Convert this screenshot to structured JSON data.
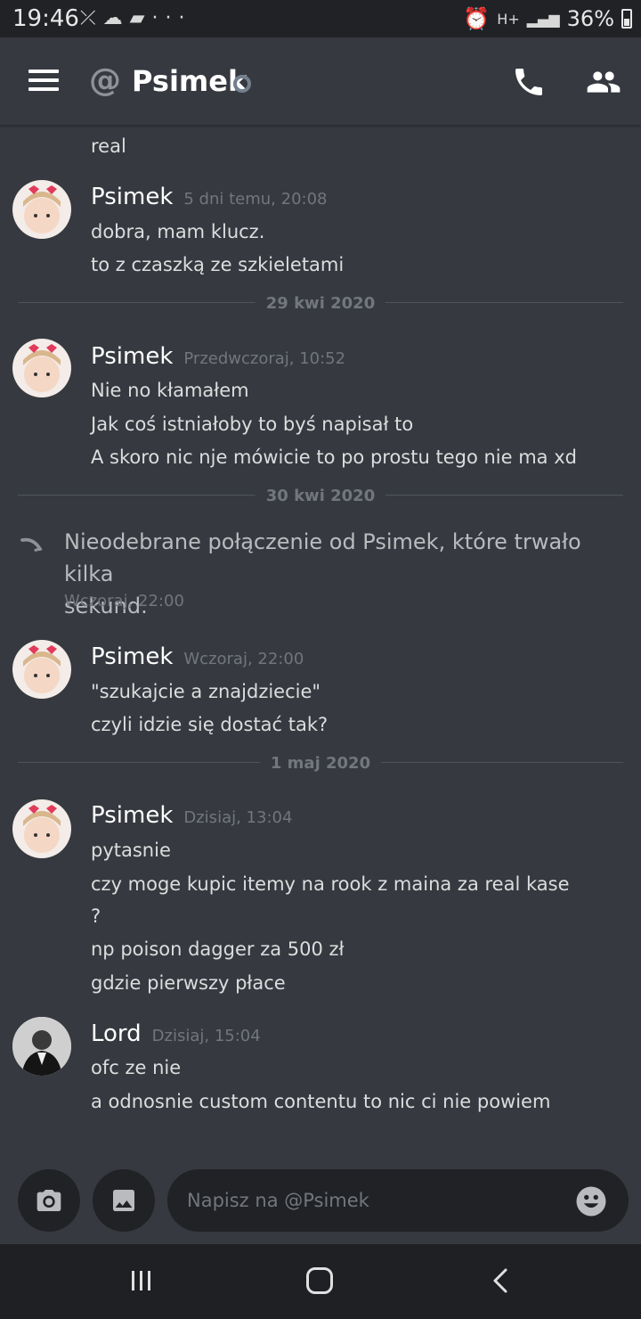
{
  "status_bar": {
    "time": "19:46",
    "notif_icons": [
      "missed-call-icon",
      "weather-icon",
      "message-icon",
      "more-icon"
    ],
    "right_icons": [
      "alarm-icon",
      "network-hplus-icon",
      "signal-icon"
    ],
    "network_label": "H+",
    "battery": "36%"
  },
  "header": {
    "at_symbol": "@",
    "title": "Psimek",
    "status": "offline",
    "icons": [
      "menu-icon",
      "call-icon",
      "friends-icon"
    ]
  },
  "messages": {
    "m0": {
      "line1": "real"
    },
    "m1": {
      "author": "Psimek",
      "timestamp": "5 dni temu, 20:08",
      "line1": "dobra, mam klucz.",
      "line2": "to z czaszką ze szkieletami"
    },
    "d1": "29 kwi 2020",
    "m2": {
      "author": "Psimek",
      "timestamp": "Przedwczoraj, 10:52",
      "line1": "Nie no kłamałem",
      "line2": "Jak coś istniałoby to byś napisał to",
      "line3": "A skoro nic nje mówicie to po prostu tego nie ma xd"
    },
    "d2": "30 kwi 2020",
    "sys": {
      "line1": "Nieodebrane połączenie od Psimek, które trwało kilka",
      "line2": "sekund.",
      "timestamp": "Wczoraj, 22:00"
    },
    "m3": {
      "author": "Psimek",
      "timestamp": "Wczoraj, 22:00",
      "line1": "\"szukajcie a znajdziecie\"",
      "line2": "czyli idzie się dostać tak?"
    },
    "d3": "1 maj 2020",
    "m4": {
      "author": "Psimek",
      "timestamp": "Dzisiaj, 13:04",
      "line1": "pytasnie",
      "line2": "czy moge kupic itemy na rook z maina za real kase",
      "line3": "?",
      "line4": "np poison dagger za 500 zł",
      "line5": "gdzie pierwszy płace"
    },
    "m5": {
      "author": "Lord",
      "timestamp": "Dzisiaj, 15:04",
      "line1": "ofc ze nie",
      "line2": "a odnosnie custom contentu to nic ci nie powiem"
    }
  },
  "composer": {
    "placeholder": "Napisz na @Psimek",
    "icons": [
      "camera-icon",
      "image-icon",
      "emoji-icon"
    ]
  },
  "colors": {
    "background": "#36393f",
    "header_dark": "#202225",
    "text": "#dcddde",
    "muted": "#72767d",
    "offline": "#747f8d"
  }
}
